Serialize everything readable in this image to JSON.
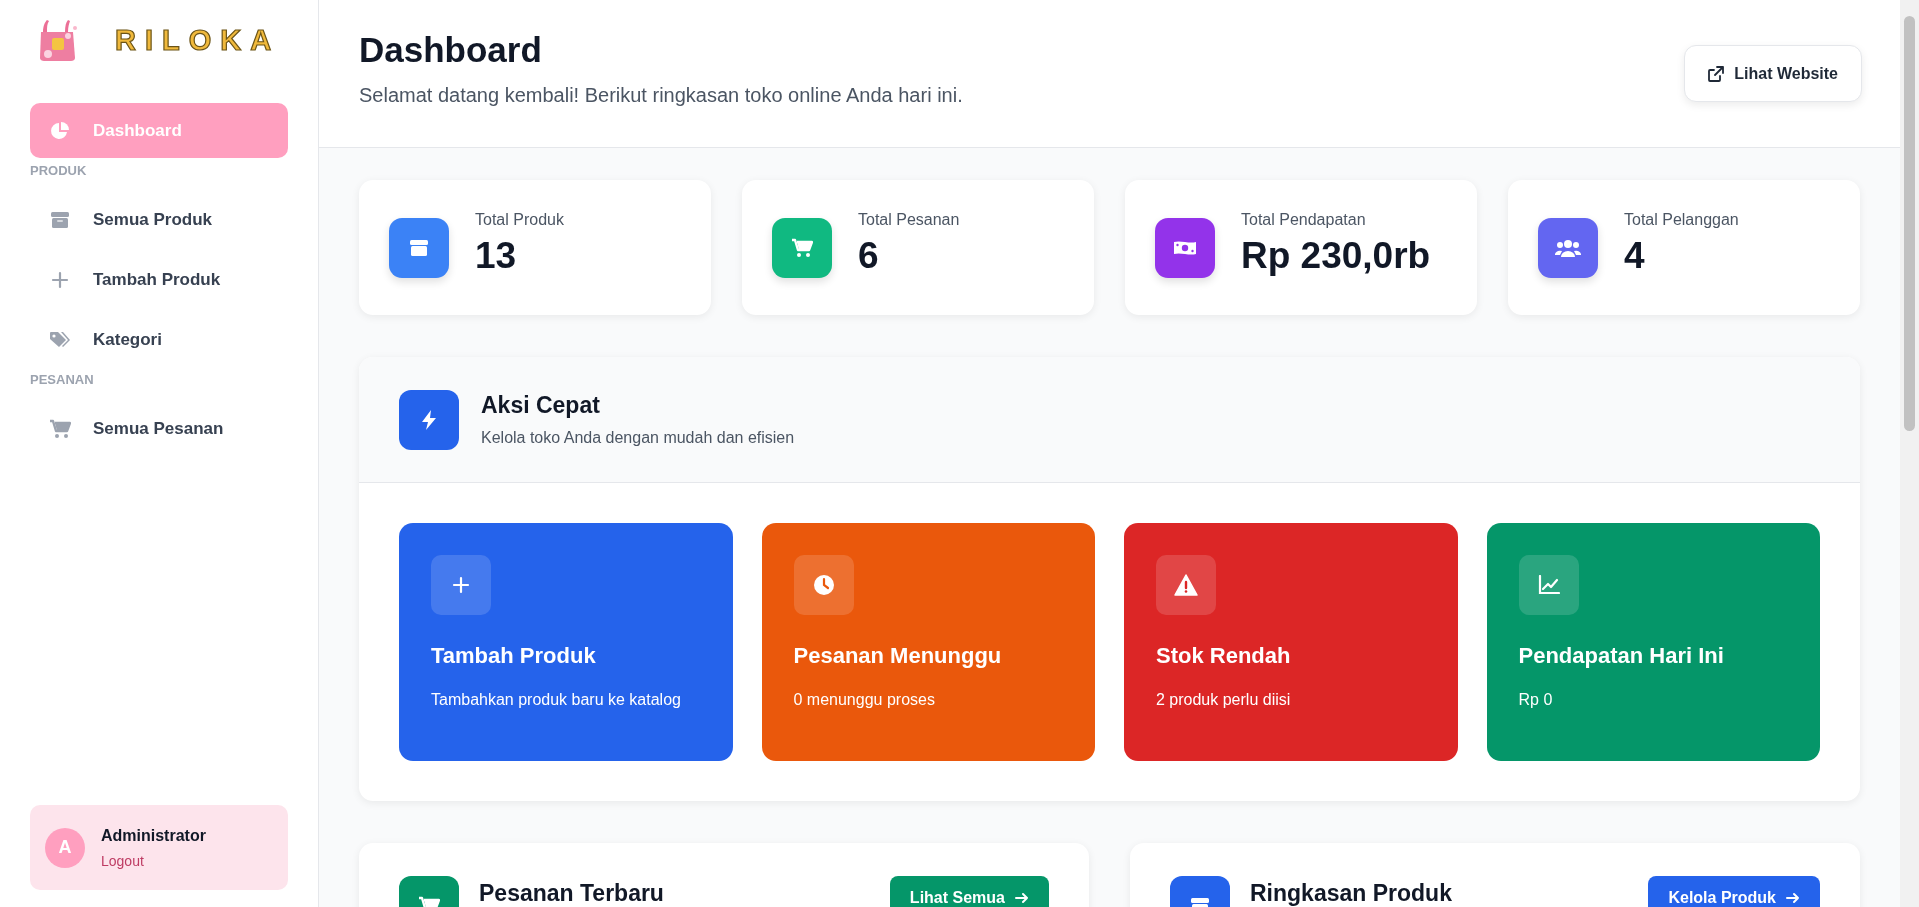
{
  "brand": {
    "name": "RILOKA"
  },
  "sidebar": {
    "items": [
      {
        "kind": "link",
        "label": "Dashboard",
        "selected": true
      },
      {
        "kind": "heading",
        "label": "PRODUK"
      },
      {
        "kind": "link",
        "label": "Semua Produk",
        "selected": false
      },
      {
        "kind": "link",
        "label": "Tambah Produk",
        "selected": false
      },
      {
        "kind": "link",
        "label": "Kategori",
        "selected": false
      },
      {
        "kind": "heading",
        "label": "PESANAN"
      },
      {
        "kind": "link",
        "label": "Semua Pesanan",
        "selected": false
      }
    ]
  },
  "user": {
    "initial": "A",
    "name": "Administrator",
    "action": "Logout"
  },
  "header": {
    "title": "Dashboard",
    "subtitle": "Selamat datang kembali! Berikut ringkasan toko online Anda hari ini.",
    "button": "Lihat Website"
  },
  "stats": [
    {
      "label": "Total Produk",
      "value": "13",
      "color": "#3b82f6"
    },
    {
      "label": "Total Pesanan",
      "value": "6",
      "color": "#10b981"
    },
    {
      "label": "Total Pendapatan",
      "value": "Rp 230,0rb",
      "color": "#9333ea"
    },
    {
      "label": "Total Pelanggan",
      "value": "4",
      "color": "#6366f1"
    }
  ],
  "quick_actions": {
    "title": "Aksi Cepat",
    "subtitle": "Kelola toko Anda dengan mudah dan efisien",
    "cards": [
      {
        "title": "Tambah Produk",
        "description": "Tambahkan produk baru ke katalog",
        "color": "#2563eb"
      },
      {
        "title": "Pesanan Menunggu",
        "description": "0 menunggu proses",
        "color": "#ea580c"
      },
      {
        "title": "Stok Rendah",
        "description": "2 produk perlu diisi",
        "color": "#dc2626"
      },
      {
        "title": "Pendapatan Hari Ini",
        "description": "Rp 0",
        "color": "#059669"
      }
    ]
  },
  "panels": [
    {
      "title": "Pesanan Terbaru",
      "button": "Lihat Semua",
      "color": "#059669"
    },
    {
      "title": "Ringkasan Produk",
      "button": "Kelola Produk",
      "color": "#2563eb"
    }
  ]
}
